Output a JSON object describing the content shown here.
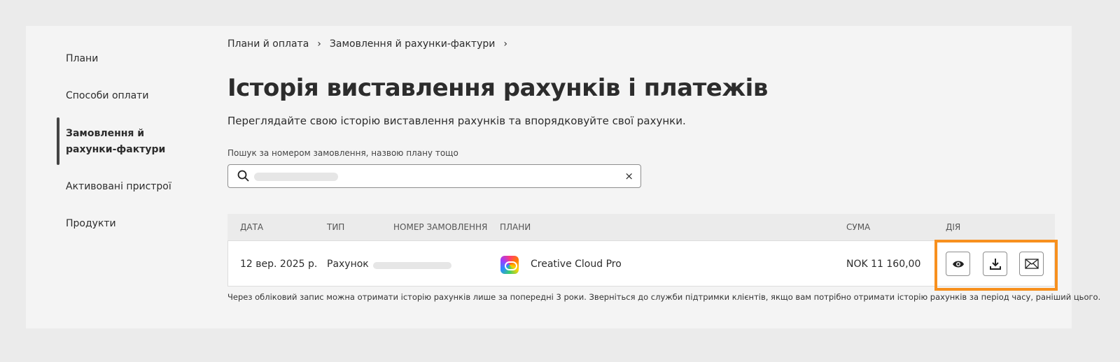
{
  "sidebar": {
    "items": [
      {
        "label": "Плани"
      },
      {
        "label": "Способи оплати"
      },
      {
        "label": "Замовлення й рахунки-фактури"
      },
      {
        "label": "Активовані пристрої"
      },
      {
        "label": "Продукти"
      }
    ]
  },
  "breadcrumb": [
    "Плани й оплата",
    "Замовлення й рахунки-фактури"
  ],
  "page": {
    "title": "Історія виставлення рахунків і платежів",
    "subtitle": "Переглядайте свою історію виставлення рахунків та впорядковуйте свої рахунки."
  },
  "search": {
    "label": "Пошук за номером замовлення, назвою плану тощо",
    "clear": "×"
  },
  "table": {
    "headers": [
      "ДАТА",
      "ТИП",
      "НОМЕР ЗАМОВЛЕННЯ",
      "ПЛАНИ",
      "СУМА",
      "ДІЯ"
    ],
    "rows": [
      {
        "date": "12 вер. 2025 р.",
        "type": "Рахунок",
        "plan": "Creative Cloud Pro",
        "amount": "NOK 11 160,00"
      }
    ]
  },
  "footnote": "Через обліковий запис можна отримати історію рахунків лише за попередні 3 роки. Зверніться до служби підтримки клієнтів, якщо вам потрібно отримати історію рахунків за період часу, раніший цього.",
  "colors": {
    "highlight": "#f7901e"
  }
}
